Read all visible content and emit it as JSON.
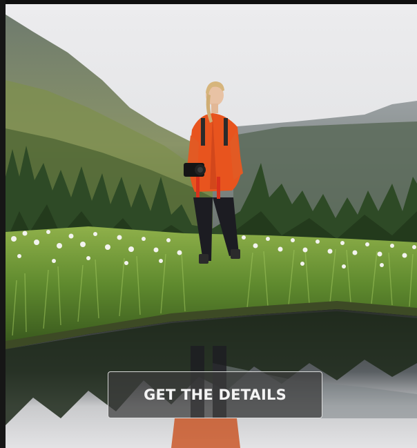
{
  "hero": {
    "image_description_icon": "hiker-in-meadow-photo",
    "cta_label": "GET THE DETAILS"
  },
  "colors": {
    "jacket": "#e8541e",
    "sky": "#e9e9ea",
    "grass": "#6f9a3a",
    "button_bg": "#3c3c3c"
  }
}
